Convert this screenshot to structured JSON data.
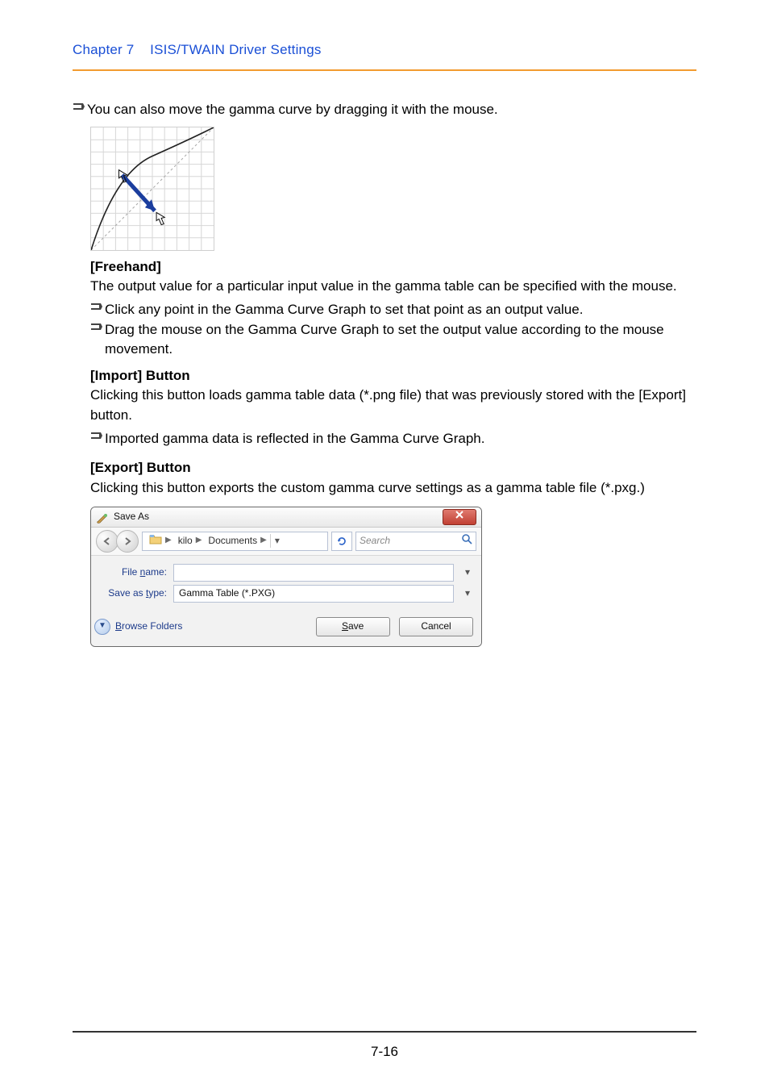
{
  "header": {
    "chapter": "Chapter 7",
    "title": "ISIS/TWAIN Driver Settings"
  },
  "body": {
    "noteMove": "You can also move the gamma curve by dragging it with the mouse.",
    "freehandHeading": "[Freehand]",
    "freehandIntro": "The output value for a particular input value in the gamma table can be specified with the mouse.",
    "freehandBullet1": "Click any point in the Gamma Curve Graph to set that point as an output value.",
    "freehandBullet2": "Drag the mouse on the Gamma Curve Graph to set the output value according to the mouse movement.",
    "importHeading": "[Import] Button",
    "importBody": "Clicking this button loads gamma table data (*.png file) that was previously stored with the [Export] button.",
    "importNote": "Imported gamma data is reflected in the Gamma Curve Graph.",
    "exportHeading": "[Export] Button",
    "exportBody": "Clicking this button exports the custom gamma curve settings as a gamma table file (*.pxg.)"
  },
  "dialog": {
    "title": "Save As",
    "breadcrumb": {
      "seg1": "kilo",
      "seg2": "Documents"
    },
    "searchPlaceholder": "Search",
    "fileNameLabel": "File name:",
    "fileNameValue": "",
    "saveAsTypeLabel": "Save as type:",
    "saveAsTypeValue": "Gamma Table (*.PXG)",
    "browseFolders": "Browse Folders",
    "saveBtn": "Save",
    "cancelBtn": "Cancel"
  },
  "pageNumber": "7-16"
}
